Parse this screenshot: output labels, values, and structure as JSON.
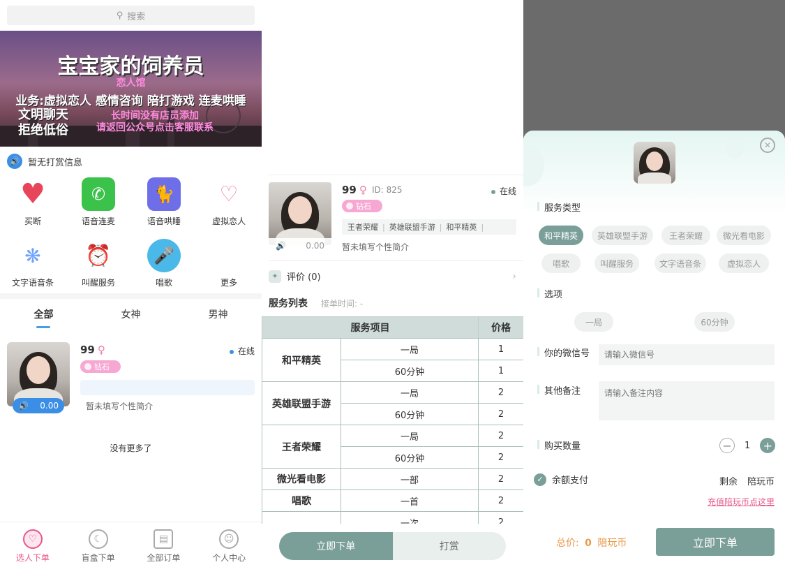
{
  "panel1": {
    "search": {
      "icon": "search-icon",
      "placeholder": "搜索"
    },
    "banner": {
      "title": "宝宝家的饲养员",
      "subtitle": "恋人馆",
      "services": "业务:虚拟恋人 感情咨询 陪打游戏 连麦哄睡",
      "slogan_line1": "文明聊天",
      "slogan_line2": "拒绝低俗",
      "note_line1": "长时间没有店员添加",
      "note_line2": "请返回公众号点击客服联系"
    },
    "notice": {
      "icon": "speaker-icon",
      "text": "暂无打赏信息"
    },
    "grid": [
      {
        "label": "买断",
        "icon": "heart-pulse-icon",
        "color": "#e8455a"
      },
      {
        "label": "语音连麦",
        "icon": "phone-icon",
        "color": "#3bc24a"
      },
      {
        "label": "语音哄睡",
        "icon": "cat-icon",
        "color": "#6e6ee8"
      },
      {
        "label": "虚拟恋人",
        "icon": "heart-face-icon",
        "color": "#f6b6c4"
      },
      {
        "label": "文字语音条",
        "icon": "soundwave-icon",
        "color": "#8fb6ff"
      },
      {
        "label": "叫醒服务",
        "icon": "alarm-clock-icon",
        "color": "#f49ac1"
      },
      {
        "label": "唱歌",
        "icon": "microphone-icon",
        "color": "#4ab8e8"
      },
      {
        "label": "更多",
        "icon": "more-icon",
        "color": "#ffffff"
      }
    ],
    "tabs": [
      "全部",
      "女神",
      "男神"
    ],
    "card": {
      "name": "99",
      "gender_icon": "♀",
      "status": "在线",
      "badge": "钻石",
      "voice_value": "0.00",
      "bio": "暂未填写个性简介"
    },
    "no_more": "没有更多了",
    "tabbar": [
      {
        "label": "选人下单",
        "icon": "heart-smile-icon"
      },
      {
        "label": "盲盒下单",
        "icon": "moon-icon"
      },
      {
        "label": "全部订单",
        "icon": "chart-icon"
      },
      {
        "label": "个人中心",
        "icon": "user-icon"
      }
    ]
  },
  "panel2": {
    "name": "99",
    "gender_icon": "♀",
    "id_text": "ID: 825",
    "status": "在线",
    "badge": "钻石",
    "tags": [
      "王者荣耀",
      "英雄联盟手游",
      "和平精英"
    ],
    "voice_value": "0.00",
    "bio": "暂未填写个性简介",
    "review_label": "评价 (0)",
    "service_title": "服务列表",
    "service_time": "接单时间: -",
    "table_headers": [
      "服务项目",
      "价格"
    ],
    "rows": [
      {
        "game": "和平精英",
        "items": [
          {
            "unit": "一局",
            "price": "1"
          },
          {
            "unit": "60分钟",
            "price": "1"
          }
        ]
      },
      {
        "game": "英雄联盟手游",
        "items": [
          {
            "unit": "一局",
            "price": "2"
          },
          {
            "unit": "60分钟",
            "price": "2"
          }
        ]
      },
      {
        "game": "王者荣耀",
        "items": [
          {
            "unit": "一局",
            "price": "2"
          },
          {
            "unit": "60分钟",
            "price": "2"
          }
        ]
      },
      {
        "game": "微光看电影",
        "items": [
          {
            "unit": "一部",
            "price": "2"
          }
        ]
      },
      {
        "game": "唱歌",
        "items": [
          {
            "unit": "一首",
            "price": "2"
          }
        ]
      },
      {
        "game": "",
        "items": [
          {
            "unit": "一次",
            "price": "2"
          }
        ]
      }
    ],
    "btn_order": "立即下单",
    "btn_tip": "打赏"
  },
  "panel3": {
    "service_type_label": "服务类型",
    "service_types": [
      "和平精英",
      "英雄联盟手游",
      "王者荣耀",
      "微光看电影",
      "唱歌",
      "叫醒服务",
      "文字语音条",
      "虚拟恋人"
    ],
    "option_label": "选项",
    "options": [
      "一局",
      "60分钟"
    ],
    "wechat_label": "你的微信号",
    "wechat_placeholder": "请输入微信号",
    "note_label": "其他备注",
    "note_placeholder": "请输入备注内容",
    "qty_label": "购买数量",
    "qty_value": "1",
    "pay_label": "余额支付",
    "remain_label": "剩余",
    "remain_currency": "陪玩币",
    "recharge_link": "充值陪玩币点这里",
    "total_label": "总价:",
    "total_value": "0",
    "total_unit": "陪玩币",
    "buy_btn": "立即下单"
  }
}
